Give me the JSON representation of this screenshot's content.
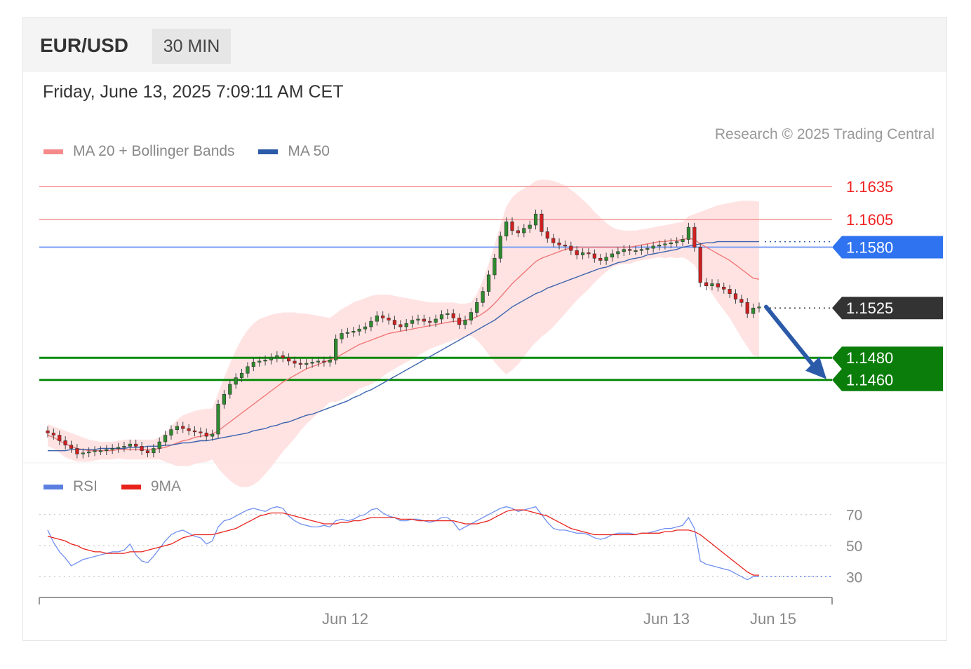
{
  "header": {
    "pair": "EUR/USD",
    "timeframe": "30 MIN",
    "datetime": "Friday, June 13, 2025 7:09:11 AM CET"
  },
  "legend": {
    "main": [
      {
        "label": "MA 20 + Bollinger Bands",
        "color": "#f58a8a"
      },
      {
        "label": "MA 50",
        "color": "#2b5aa8"
      }
    ],
    "rsi": [
      {
        "label": "RSI",
        "color": "#5b7fe0"
      },
      {
        "label": "9MA",
        "color": "#e8221b"
      }
    ],
    "credit": "Research © 2025 Trading Central"
  },
  "chart_data": [
    {
      "type": "candlestick",
      "ylim": [
        1.1385,
        1.1645
      ],
      "x_labels": [
        "Jun 12",
        "Jun 13",
        "Jun 15"
      ],
      "levels": [
        {
          "value": 1.1635,
          "label": "1.1635",
          "color": "#f35b5b",
          "kind": "resistance"
        },
        {
          "value": 1.1605,
          "label": "1.1605",
          "color": "#f35b5b",
          "kind": "resistance"
        },
        {
          "value": 1.158,
          "label": "1.1580",
          "color": "#2f73f0",
          "kind": "pivot"
        },
        {
          "value": 1.1525,
          "label": "1.1525",
          "color": "#333333",
          "kind": "last"
        },
        {
          "value": 1.148,
          "label": "1.1480",
          "color": "#0a7d0a",
          "kind": "support"
        },
        {
          "value": 1.146,
          "label": "1.1460",
          "color": "#0a7d0a",
          "kind": "support"
        }
      ],
      "close": [
        1.1412,
        1.141,
        1.1405,
        1.1401,
        1.1398,
        1.1393,
        1.1394,
        1.1395,
        1.1396,
        1.1396,
        1.1397,
        1.1398,
        1.1399,
        1.14,
        1.1402,
        1.14,
        1.1396,
        1.1394,
        1.1398,
        1.1404,
        1.141,
        1.1415,
        1.1418,
        1.1416,
        1.1414,
        1.1413,
        1.1412,
        1.1409,
        1.1411,
        1.1438,
        1.1447,
        1.1456,
        1.1462,
        1.1466,
        1.1472,
        1.1476,
        1.1477,
        1.1478,
        1.148,
        1.1482,
        1.148,
        1.1477,
        1.1475,
        1.1474,
        1.1475,
        1.1476,
        1.1477,
        1.1476,
        1.1478,
        1.1497,
        1.1502,
        1.1503,
        1.1504,
        1.1506,
        1.1508,
        1.1513,
        1.1518,
        1.1516,
        1.1514,
        1.151,
        1.1508,
        1.1511,
        1.1514,
        1.1515,
        1.1513,
        1.1512,
        1.1515,
        1.1519,
        1.152,
        1.1516,
        1.151,
        1.1514,
        1.1521,
        1.153,
        1.154,
        1.1555,
        1.157,
        1.159,
        1.1603,
        1.1595,
        1.1593,
        1.1597,
        1.16,
        1.161,
        1.1594,
        1.1588,
        1.1584,
        1.1582,
        1.1581,
        1.1577,
        1.1573,
        1.1575,
        1.1574,
        1.157,
        1.1568,
        1.1571,
        1.1574,
        1.1576,
        1.1578,
        1.1577,
        1.1577,
        1.1578,
        1.1579,
        1.1581,
        1.1582,
        1.1583,
        1.1584,
        1.1585,
        1.1587,
        1.1598,
        1.158,
        1.1548,
        1.1545,
        1.1547,
        1.1544,
        1.1542,
        1.1538,
        1.1533,
        1.153,
        1.152,
        1.1525,
        1.1526
      ],
      "ma20": [
        1.141,
        1.1408,
        1.1405,
        1.1402,
        1.14,
        1.1398,
        1.1397,
        1.1396,
        1.1396,
        1.1396,
        1.1396,
        1.1396,
        1.1397,
        1.1397,
        1.1397,
        1.1397,
        1.1397,
        1.1397,
        1.1397,
        1.1398,
        1.1399,
        1.1401,
        1.1403,
        1.1405,
        1.1406,
        1.1408,
        1.1409,
        1.141,
        1.1411,
        1.1414,
        1.1418,
        1.1422,
        1.1426,
        1.143,
        1.1434,
        1.1438,
        1.1442,
        1.1446,
        1.145,
        1.1454,
        1.1458,
        1.1461,
        1.1464,
        1.1467,
        1.147,
        1.1472,
        1.1474,
        1.1476,
        1.1478,
        1.148,
        1.1483,
        1.1486,
        1.1489,
        1.1492,
        1.1494,
        1.1496,
        1.1498,
        1.15,
        1.1502,
        1.1503,
        1.1504,
        1.1505,
        1.1506,
        1.1507,
        1.1508,
        1.1509,
        1.151,
        1.1511,
        1.1512,
        1.1513,
        1.1513,
        1.1514,
        1.1515,
        1.1517,
        1.152,
        1.1524,
        1.1529,
        1.1535,
        1.1541,
        1.1547,
        1.1552,
        1.1557,
        1.1562,
        1.1567,
        1.157,
        1.1572,
        1.1574,
        1.1576,
        1.1578,
        1.1579,
        1.158,
        1.158,
        1.158,
        1.158,
        1.158,
        1.158,
        1.158,
        1.158,
        1.158,
        1.158,
        1.1581,
        1.1582,
        1.1583,
        1.1584,
        1.1585,
        1.1585,
        1.1586,
        1.1586,
        1.1587,
        1.1588,
        1.1587,
        1.1583,
        1.158,
        1.1577,
        1.1574,
        1.1571,
        1.1568,
        1.1564,
        1.156,
        1.1556,
        1.1552,
        1.1551
      ],
      "bb_upper": [
        1.142,
        1.1418,
        1.1416,
        1.1414,
        1.1412,
        1.141,
        1.1408,
        1.1406,
        1.1405,
        1.1404,
        1.1404,
        1.1404,
        1.1405,
        1.1406,
        1.1406,
        1.1406,
        1.1406,
        1.1406,
        1.1406,
        1.1408,
        1.1412,
        1.1418,
        1.1424,
        1.1428,
        1.143,
        1.1432,
        1.1433,
        1.1434,
        1.1434,
        1.1448,
        1.1462,
        1.1475,
        1.1487,
        1.1497,
        1.1505,
        1.1511,
        1.1515,
        1.1517,
        1.1519,
        1.152,
        1.1521,
        1.1521,
        1.1521,
        1.152,
        1.152,
        1.1519,
        1.1518,
        1.1517,
        1.1516,
        1.152,
        1.1524,
        1.1527,
        1.153,
        1.1532,
        1.1534,
        1.1536,
        1.1537,
        1.1537,
        1.1537,
        1.1536,
        1.1535,
        1.1534,
        1.1533,
        1.1532,
        1.1531,
        1.153,
        1.153,
        1.153,
        1.153,
        1.153,
        1.1529,
        1.1529,
        1.153,
        1.1538,
        1.155,
        1.1565,
        1.1582,
        1.16,
        1.1617,
        1.1625,
        1.163,
        1.1633,
        1.1636,
        1.164,
        1.1641,
        1.1641,
        1.164,
        1.1638,
        1.1636,
        1.1632,
        1.1628,
        1.1623,
        1.1618,
        1.1612,
        1.1607,
        1.1602,
        1.1598,
        1.1596,
        1.1595,
        1.1595,
        1.1595,
        1.1596,
        1.1597,
        1.1598,
        1.1599,
        1.16,
        1.1601,
        1.1602,
        1.1603,
        1.1608,
        1.161,
        1.1612,
        1.1614,
        1.1616,
        1.1618,
        1.1619,
        1.162,
        1.1621,
        1.1622,
        1.1622,
        1.1622,
        1.1621
      ],
      "bb_lower": [
        1.14,
        1.1398,
        1.1394,
        1.139,
        1.1388,
        1.1386,
        1.1386,
        1.1386,
        1.1387,
        1.1388,
        1.1388,
        1.1388,
        1.1389,
        1.1388,
        1.1388,
        1.1388,
        1.1388,
        1.1388,
        1.1388,
        1.1388,
        1.1386,
        1.1384,
        1.1382,
        1.1382,
        1.1382,
        1.1384,
        1.1385,
        1.1386,
        1.1388,
        1.138,
        1.1374,
        1.1369,
        1.1365,
        1.1363,
        1.1363,
        1.1365,
        1.1369,
        1.1375,
        1.1381,
        1.1388,
        1.1395,
        1.1401,
        1.1407,
        1.1414,
        1.142,
        1.1425,
        1.143,
        1.1435,
        1.144,
        1.144,
        1.1442,
        1.1445,
        1.1448,
        1.1452,
        1.1454,
        1.1456,
        1.1459,
        1.1463,
        1.1467,
        1.147,
        1.1473,
        1.1476,
        1.1479,
        1.1482,
        1.1485,
        1.1488,
        1.149,
        1.1492,
        1.1494,
        1.1496,
        1.1497,
        1.1499,
        1.15,
        1.1496,
        1.149,
        1.1483,
        1.1476,
        1.147,
        1.1465,
        1.1469,
        1.1474,
        1.1481,
        1.1488,
        1.1494,
        1.1499,
        1.1503,
        1.1508,
        1.1514,
        1.152,
        1.1526,
        1.1532,
        1.1537,
        1.1542,
        1.1548,
        1.1553,
        1.1558,
        1.1562,
        1.1564,
        1.1565,
        1.1565,
        1.1567,
        1.1568,
        1.1569,
        1.157,
        1.1571,
        1.157,
        1.1571,
        1.157,
        1.1571,
        1.1568,
        1.1564,
        1.1554,
        1.1546,
        1.1538,
        1.153,
        1.1523,
        1.1516,
        1.1507,
        1.1498,
        1.149,
        1.1482,
        1.1481
      ],
      "ma50": [
        1.1396,
        1.1396,
        1.1396,
        1.1396,
        1.1397,
        1.1397,
        1.1397,
        1.1397,
        1.1397,
        1.1398,
        1.1398,
        1.1398,
        1.1398,
        1.1398,
        1.1399,
        1.1399,
        1.1399,
        1.14,
        1.14,
        1.14,
        1.1401,
        1.1401,
        1.1402,
        1.1403,
        1.1403,
        1.1404,
        1.1405,
        1.1405,
        1.1406,
        1.1407,
        1.1408,
        1.1409,
        1.141,
        1.1411,
        1.1412,
        1.1414,
        1.1415,
        1.1416,
        1.1418,
        1.1419,
        1.1421,
        1.1422,
        1.1424,
        1.1426,
        1.1428,
        1.1429,
        1.1431,
        1.1433,
        1.1435,
        1.1437,
        1.1439,
        1.1441,
        1.1444,
        1.1446,
        1.1449,
        1.1451,
        1.1454,
        1.1457,
        1.146,
        1.1463,
        1.1466,
        1.1469,
        1.1472,
        1.1475,
        1.1478,
        1.1481,
        1.1484,
        1.1487,
        1.149,
        1.1493,
        1.1496,
        1.1499,
        1.1502,
        1.1505,
        1.1508,
        1.1511,
        1.1514,
        1.1518,
        1.1522,
        1.1526,
        1.1529,
        1.1532,
        1.1535,
        1.1538,
        1.154,
        1.1543,
        1.1545,
        1.1547,
        1.1549,
        1.1551,
        1.1553,
        1.1555,
        1.1557,
        1.1559,
        1.1561,
        1.1562,
        1.1564,
        1.1566,
        1.1567,
        1.1569,
        1.157,
        1.1571,
        1.1573,
        1.1574,
        1.1575,
        1.1576,
        1.1577,
        1.1578,
        1.158,
        1.1581,
        1.1582,
        1.1583,
        1.1584,
        1.1584,
        1.1585,
        1.1585,
        1.1585,
        1.1585,
        1.1585,
        1.1585,
        1.1585,
        1.1585
      ]
    },
    {
      "type": "line",
      "x_labels": [
        "Jun 12",
        "Jun 13",
        "Jun 15"
      ],
      "y_ticks": [
        70,
        50,
        30
      ],
      "ylim": [
        22,
        78
      ],
      "series": [
        {
          "name": "RSI",
          "color": "#6f8ff0",
          "values": [
            60,
            52,
            46,
            42,
            37,
            39,
            41,
            42,
            43,
            44,
            45,
            46,
            46,
            47,
            51,
            44,
            40,
            39,
            43,
            48,
            53,
            57,
            59,
            60,
            58,
            56,
            55,
            51,
            53,
            62,
            66,
            67,
            69,
            71,
            73,
            74,
            73,
            72,
            74,
            75,
            74,
            69,
            66,
            64,
            63,
            62,
            62,
            63,
            62,
            66,
            67,
            66,
            67,
            69,
            70,
            73,
            74,
            71,
            69,
            68,
            66,
            66,
            67,
            67,
            66,
            65,
            66,
            68,
            68,
            65,
            60,
            62,
            64,
            66,
            68,
            70,
            72,
            74,
            75,
            74,
            72,
            73,
            74,
            75,
            70,
            65,
            61,
            60,
            60,
            59,
            58,
            58,
            57,
            55,
            54,
            55,
            57,
            58,
            58,
            58,
            57,
            58,
            58,
            59,
            60,
            61,
            61,
            62,
            63,
            68,
            61,
            40,
            38,
            37,
            36,
            35,
            34,
            32,
            30,
            28,
            30,
            30
          ]
        },
        {
          "name": "9MA",
          "color": "#e8221b",
          "values": [
            56,
            55,
            54,
            53,
            51,
            50,
            48,
            47,
            46,
            46,
            45,
            45,
            45,
            45,
            46,
            46,
            46,
            47,
            48,
            49,
            50,
            51,
            53,
            55,
            56,
            57,
            57,
            57,
            57,
            58,
            59,
            60,
            61,
            63,
            65,
            67,
            69,
            70,
            71,
            71,
            71,
            70,
            69,
            68,
            67,
            66,
            65,
            64,
            64,
            64,
            65,
            65,
            66,
            66,
            67,
            68,
            68,
            68,
            68,
            68,
            67,
            67,
            67,
            66,
            66,
            66,
            66,
            66,
            66,
            66,
            65,
            64,
            64,
            64,
            65,
            66,
            68,
            70,
            72,
            73,
            73,
            73,
            72,
            71,
            70,
            69,
            67,
            65,
            63,
            61,
            60,
            59,
            58,
            57,
            57,
            57,
            57,
            57,
            57,
            57,
            57,
            58,
            58,
            58,
            58,
            59,
            59,
            60,
            60,
            60,
            59,
            57,
            54,
            51,
            48,
            45,
            42,
            39,
            36,
            33,
            31,
            31
          ]
        }
      ]
    }
  ]
}
